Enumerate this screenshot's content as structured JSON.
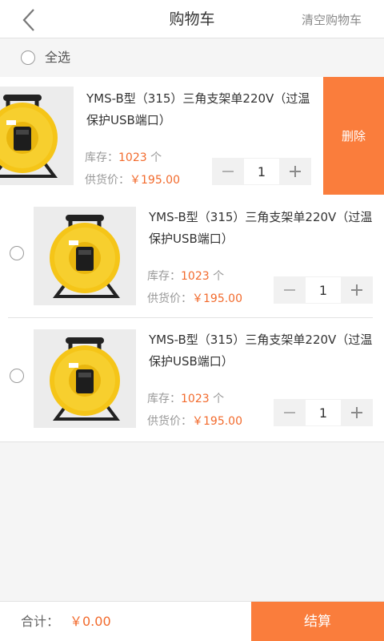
{
  "header": {
    "title": "购物车",
    "clear_label": "清空购物车"
  },
  "select_all": {
    "label": "全选",
    "checked": false
  },
  "items": [
    {
      "name": "YMS-B型（315）三角支架单220V（过温保护USB端口）",
      "stock_label": "库存：",
      "stock_value": "1023",
      "stock_unit": " 个",
      "price_label": "供货价：",
      "price_value": "￥195.00",
      "quantity": "1",
      "checked": false,
      "swiped_open": true,
      "delete_label": "删除"
    },
    {
      "name": "YMS-B型（315）三角支架单220V（过温保护USB端口）",
      "stock_label": "库存：",
      "stock_value": "1023",
      "stock_unit": " 个",
      "price_label": "供货价：",
      "price_value": "￥195.00",
      "quantity": "1",
      "checked": false
    },
    {
      "name": "YMS-B型（315）三角支架单220V（过温保护USB端口）",
      "stock_label": "库存：",
      "stock_value": "1023",
      "stock_unit": " 个",
      "price_label": "供货价：",
      "price_value": "￥195.00",
      "quantity": "1",
      "checked": false
    }
  ],
  "footer": {
    "total_label": "合计：",
    "total_value": "￥0.00",
    "checkout_label": "结算"
  },
  "colors": {
    "accent": "#fa7d3c",
    "price": "#f26a2c",
    "product_yellow": "#f5c518"
  },
  "icons": {
    "back": "chevron-left-icon",
    "minus": "minus-icon",
    "plus": "plus-icon"
  }
}
